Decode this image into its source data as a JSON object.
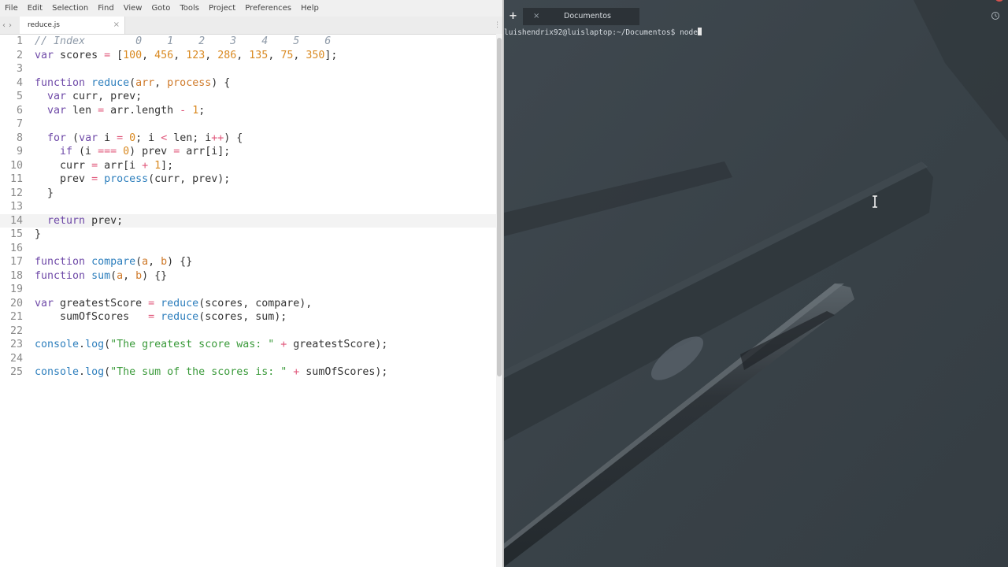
{
  "editor": {
    "menu": [
      "File",
      "Edit",
      "Selection",
      "Find",
      "View",
      "Goto",
      "Tools",
      "Project",
      "Preferences",
      "Help"
    ],
    "tab": {
      "filename": "reduce.js",
      "close_glyph": "×"
    },
    "nav_back_glyph": "‹",
    "nav_forward_glyph": "›",
    "overflow_glyph": "⋮",
    "current_line": 14,
    "lines": [
      {
        "n": "1",
        "tokens": [
          [
            "cm",
            "// Index        0    1    2    3    4    5    6"
          ]
        ]
      },
      {
        "n": "2",
        "tokens": [
          [
            "kw",
            "var"
          ],
          [
            "tx",
            " scores "
          ],
          [
            "op",
            "="
          ],
          [
            "tx",
            " ["
          ],
          [
            "nu",
            "100"
          ],
          [
            "tx",
            ", "
          ],
          [
            "nu",
            "456"
          ],
          [
            "tx",
            ", "
          ],
          [
            "nu",
            "123"
          ],
          [
            "tx",
            ", "
          ],
          [
            "nu",
            "286"
          ],
          [
            "tx",
            ", "
          ],
          [
            "nu",
            "135"
          ],
          [
            "tx",
            ", "
          ],
          [
            "nu",
            "75"
          ],
          [
            "tx",
            ", "
          ],
          [
            "nu",
            "350"
          ],
          [
            "tx",
            "];"
          ]
        ]
      },
      {
        "n": "3",
        "tokens": []
      },
      {
        "n": "4",
        "tokens": [
          [
            "kw",
            "function"
          ],
          [
            "tx",
            " "
          ],
          [
            "fn",
            "reduce"
          ],
          [
            "tx",
            "("
          ],
          [
            "pa",
            "arr"
          ],
          [
            "tx",
            ", "
          ],
          [
            "pa",
            "process"
          ],
          [
            "tx",
            ") {"
          ]
        ]
      },
      {
        "n": "5",
        "tokens": [
          [
            "tx",
            "  "
          ],
          [
            "kw",
            "var"
          ],
          [
            "tx",
            " curr, prev;"
          ]
        ]
      },
      {
        "n": "6",
        "tokens": [
          [
            "tx",
            "  "
          ],
          [
            "kw",
            "var"
          ],
          [
            "tx",
            " len "
          ],
          [
            "op",
            "="
          ],
          [
            "tx",
            " arr.length "
          ],
          [
            "op",
            "-"
          ],
          [
            "tx",
            " "
          ],
          [
            "nu",
            "1"
          ],
          [
            "tx",
            ";"
          ]
        ]
      },
      {
        "n": "7",
        "tokens": []
      },
      {
        "n": "8",
        "tokens": [
          [
            "tx",
            "  "
          ],
          [
            "kw",
            "for"
          ],
          [
            "tx",
            " ("
          ],
          [
            "kw",
            "var"
          ],
          [
            "tx",
            " i "
          ],
          [
            "op",
            "="
          ],
          [
            "tx",
            " "
          ],
          [
            "nu",
            "0"
          ],
          [
            "tx",
            "; i "
          ],
          [
            "op",
            "<"
          ],
          [
            "tx",
            " len; i"
          ],
          [
            "op",
            "++"
          ],
          [
            "tx",
            ") {"
          ]
        ]
      },
      {
        "n": "9",
        "tokens": [
          [
            "tx",
            "    "
          ],
          [
            "kw",
            "if"
          ],
          [
            "tx",
            " (i "
          ],
          [
            "op",
            "==="
          ],
          [
            "tx",
            " "
          ],
          [
            "nu",
            "0"
          ],
          [
            "tx",
            ") prev "
          ],
          [
            "op",
            "="
          ],
          [
            "tx",
            " arr[i];"
          ]
        ]
      },
      {
        "n": "10",
        "tokens": [
          [
            "tx",
            "    curr "
          ],
          [
            "op",
            "="
          ],
          [
            "tx",
            " arr[i "
          ],
          [
            "op",
            "+"
          ],
          [
            "tx",
            " "
          ],
          [
            "nu",
            "1"
          ],
          [
            "tx",
            "];"
          ]
        ]
      },
      {
        "n": "11",
        "tokens": [
          [
            "tx",
            "    prev "
          ],
          [
            "op",
            "="
          ],
          [
            "tx",
            " "
          ],
          [
            "fn",
            "process"
          ],
          [
            "tx",
            "(curr, prev);"
          ]
        ]
      },
      {
        "n": "12",
        "tokens": [
          [
            "tx",
            "  }"
          ]
        ]
      },
      {
        "n": "13",
        "tokens": []
      },
      {
        "n": "14",
        "tokens": [
          [
            "tx",
            "  "
          ],
          [
            "kw",
            "return"
          ],
          [
            "tx",
            " prev;"
          ]
        ]
      },
      {
        "n": "15",
        "tokens": [
          [
            "tx",
            "}"
          ]
        ]
      },
      {
        "n": "16",
        "tokens": []
      },
      {
        "n": "17",
        "tokens": [
          [
            "kw",
            "function"
          ],
          [
            "tx",
            " "
          ],
          [
            "fn",
            "compare"
          ],
          [
            "tx",
            "("
          ],
          [
            "pa",
            "a"
          ],
          [
            "tx",
            ", "
          ],
          [
            "pa",
            "b"
          ],
          [
            "tx",
            ") {}"
          ]
        ]
      },
      {
        "n": "18",
        "tokens": [
          [
            "kw",
            "function"
          ],
          [
            "tx",
            " "
          ],
          [
            "fn",
            "sum"
          ],
          [
            "tx",
            "("
          ],
          [
            "pa",
            "a"
          ],
          [
            "tx",
            ", "
          ],
          [
            "pa",
            "b"
          ],
          [
            "tx",
            ") {}"
          ]
        ]
      },
      {
        "n": "19",
        "tokens": []
      },
      {
        "n": "20",
        "tokens": [
          [
            "kw",
            "var"
          ],
          [
            "tx",
            " greatestScore "
          ],
          [
            "op",
            "="
          ],
          [
            "tx",
            " "
          ],
          [
            "fn",
            "reduce"
          ],
          [
            "tx",
            "(scores, compare),"
          ]
        ]
      },
      {
        "n": "21",
        "tokens": [
          [
            "tx",
            "    sumOfScores   "
          ],
          [
            "op",
            "="
          ],
          [
            "tx",
            " "
          ],
          [
            "fn",
            "reduce"
          ],
          [
            "tx",
            "(scores, sum);"
          ]
        ]
      },
      {
        "n": "22",
        "tokens": []
      },
      {
        "n": "23",
        "tokens": [
          [
            "fn",
            "console"
          ],
          [
            "tx",
            "."
          ],
          [
            "fn",
            "log"
          ],
          [
            "tx",
            "("
          ],
          [
            "st",
            "\"The greatest score was: \""
          ],
          [
            "tx",
            " "
          ],
          [
            "op",
            "+"
          ],
          [
            "tx",
            " greatestScore);"
          ]
        ]
      },
      {
        "n": "24",
        "tokens": []
      },
      {
        "n": "25",
        "tokens": [
          [
            "fn",
            "console"
          ],
          [
            "tx",
            "."
          ],
          [
            "fn",
            "log"
          ],
          [
            "tx",
            "("
          ],
          [
            "st",
            "\"The sum of the scores is: \""
          ],
          [
            "tx",
            " "
          ],
          [
            "op",
            "+"
          ],
          [
            "tx",
            " sumOfScores);"
          ]
        ]
      }
    ]
  },
  "terminal": {
    "add_tab_glyph": "+",
    "tab": {
      "label": "Documentos",
      "close_glyph": "×"
    },
    "prompt": "luishendrix92@luislaptop:~/Documentos$ ",
    "command": "node",
    "colors": {
      "background": "#3b444b",
      "text": "#d6dbe0"
    }
  }
}
